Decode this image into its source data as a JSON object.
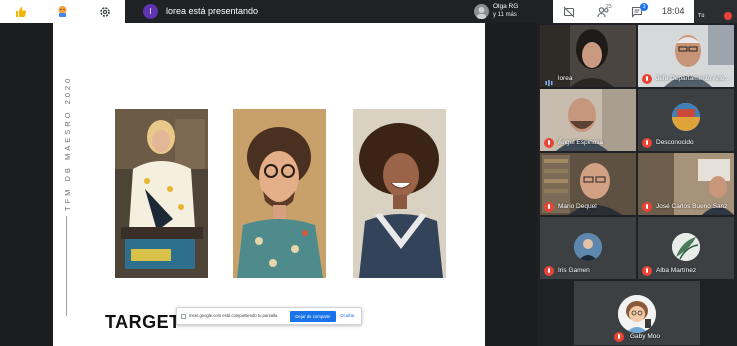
{
  "topbar": {
    "presenter_initial": "l",
    "presenter_text": "lorea está presentando",
    "participants_names": "Olga RG",
    "participants_more": "y 11 más",
    "people_count": "23",
    "chat_count": "3",
    "clock": "18:04",
    "self_initials": "Tú"
  },
  "slide": {
    "vertical_title": "TFM DB MAESRO 2020",
    "heading": "TARGET"
  },
  "share_bar": {
    "message": "meet.google.com está compartiendo tu pantalla.",
    "stop_label": "Dejar de compartir",
    "hide_label": "Ocultar"
  },
  "participants": [
    {
      "name": "lorea",
      "muted": false
    },
    {
      "name": "Jefe Departamento Arte...",
      "muted": true
    },
    {
      "name": "Ángel Espinosa",
      "muted": true
    },
    {
      "name": "Desconocido",
      "muted": true
    },
    {
      "name": "Mario Dequel",
      "muted": true
    },
    {
      "name": "José Carlos Bueno Sanz",
      "muted": true
    },
    {
      "name": "Iris Gamen",
      "muted": true
    },
    {
      "name": "Alba Martínez",
      "muted": true
    },
    {
      "name": "Gaby Moo",
      "muted": true
    }
  ],
  "colors": {
    "accent": "#1a73e8",
    "presenter_avatar": "#5e35b1",
    "muted_red": "#ea4335",
    "tile_bg": "#3c4043"
  }
}
